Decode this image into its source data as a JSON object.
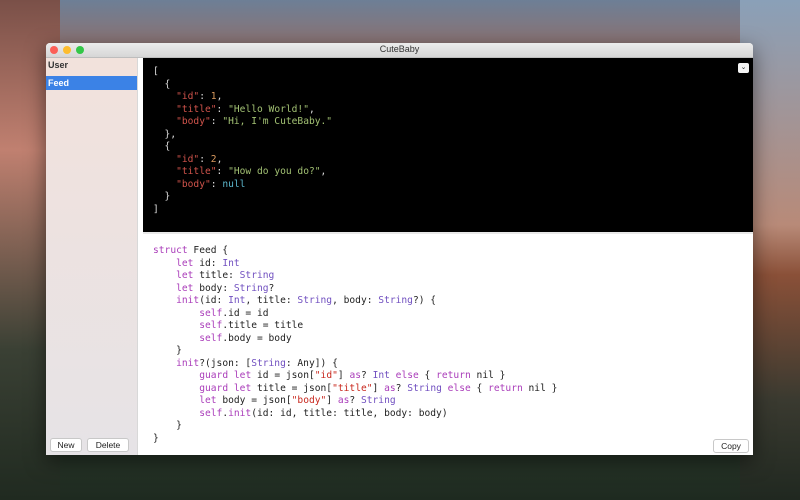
{
  "window": {
    "title": "CuteBaby"
  },
  "sidebar": {
    "header": "User",
    "items": [
      {
        "label": "Feed"
      }
    ],
    "new_label": "New",
    "delete_label": "Delete"
  },
  "json_pane": {
    "dropdown_icon": "chevron-down-icon",
    "lines": [
      [
        [
          "[",
          ""
        ]
      ],
      [
        [
          "  {",
          ""
        ]
      ],
      [
        [
          "    ",
          ""
        ],
        [
          "\"id\"",
          "jk"
        ],
        [
          ": ",
          ""
        ],
        [
          "1",
          "jn"
        ],
        [
          ",",
          ""
        ]
      ],
      [
        [
          "    ",
          ""
        ],
        [
          "\"title\"",
          "jk"
        ],
        [
          ": ",
          ""
        ],
        [
          "\"Hello World!\"",
          "js"
        ],
        [
          ",",
          ""
        ]
      ],
      [
        [
          "    ",
          ""
        ],
        [
          "\"body\"",
          "jk"
        ],
        [
          ": ",
          ""
        ],
        [
          "\"Hi, I'm CuteBaby.\"",
          "js"
        ]
      ],
      [
        [
          "  },",
          ""
        ]
      ],
      [
        [
          "  {",
          ""
        ]
      ],
      [
        [
          "    ",
          ""
        ],
        [
          "\"id\"",
          "jk"
        ],
        [
          ": ",
          ""
        ],
        [
          "2",
          "jn"
        ],
        [
          ",",
          ""
        ]
      ],
      [
        [
          "    ",
          ""
        ],
        [
          "\"title\"",
          "jk"
        ],
        [
          ": ",
          ""
        ],
        [
          "\"How do you do?\"",
          "js"
        ],
        [
          ",",
          ""
        ]
      ],
      [
        [
          "    ",
          ""
        ],
        [
          "\"body\"",
          "jk"
        ],
        [
          ": ",
          ""
        ],
        [
          "null",
          "jl"
        ]
      ],
      [
        [
          "  }",
          ""
        ]
      ],
      [
        [
          "]",
          ""
        ]
      ]
    ]
  },
  "code_pane": {
    "copy_label": "Copy",
    "lines": [
      [
        [
          "struct",
          "k"
        ],
        [
          " Feed {",
          ""
        ]
      ],
      [
        [
          "    ",
          ""
        ],
        [
          "let",
          "k"
        ],
        [
          " id: ",
          ""
        ],
        [
          "Int",
          "t"
        ]
      ],
      [
        [
          "    ",
          ""
        ],
        [
          "let",
          "k"
        ],
        [
          " title: ",
          ""
        ],
        [
          "String",
          "t"
        ]
      ],
      [
        [
          "    ",
          ""
        ],
        [
          "let",
          "k"
        ],
        [
          " body: ",
          ""
        ],
        [
          "String",
          "t"
        ],
        [
          "?",
          ""
        ]
      ],
      [
        [
          "    ",
          ""
        ],
        [
          "init",
          "k"
        ],
        [
          "(id: ",
          ""
        ],
        [
          "Int",
          "t"
        ],
        [
          ", title: ",
          ""
        ],
        [
          "String",
          "t"
        ],
        [
          ", body: ",
          ""
        ],
        [
          "String",
          "t"
        ],
        [
          "?) {",
          ""
        ]
      ],
      [
        [
          "        ",
          ""
        ],
        [
          "self",
          "k"
        ],
        [
          ".id = id",
          ""
        ]
      ],
      [
        [
          "        ",
          ""
        ],
        [
          "self",
          "k"
        ],
        [
          ".title = title",
          ""
        ]
      ],
      [
        [
          "        ",
          ""
        ],
        [
          "self",
          "k"
        ],
        [
          ".body = body",
          ""
        ]
      ],
      [
        [
          "    }",
          ""
        ]
      ],
      [
        [
          "    ",
          ""
        ],
        [
          "init",
          "k"
        ],
        [
          "?(json: [",
          ""
        ],
        [
          "String",
          "t"
        ],
        [
          ": Any]) {",
          ""
        ]
      ],
      [
        [
          "        ",
          ""
        ],
        [
          "guard",
          "k"
        ],
        [
          " ",
          ""
        ],
        [
          "let",
          "k"
        ],
        [
          " id = json[",
          ""
        ],
        [
          "\"id\"",
          "s"
        ],
        [
          "] ",
          ""
        ],
        [
          "as",
          "k"
        ],
        [
          "? ",
          ""
        ],
        [
          "Int",
          "t"
        ],
        [
          " ",
          ""
        ],
        [
          "else",
          "k"
        ],
        [
          " { ",
          ""
        ],
        [
          "return",
          "k"
        ],
        [
          " nil }",
          ""
        ]
      ],
      [
        [
          "        ",
          ""
        ],
        [
          "guard",
          "k"
        ],
        [
          " ",
          ""
        ],
        [
          "let",
          "k"
        ],
        [
          " title = json[",
          ""
        ],
        [
          "\"title\"",
          "s"
        ],
        [
          "] ",
          ""
        ],
        [
          "as",
          "k"
        ],
        [
          "? ",
          ""
        ],
        [
          "String",
          "t"
        ],
        [
          " ",
          ""
        ],
        [
          "else",
          "k"
        ],
        [
          " { ",
          ""
        ],
        [
          "return",
          "k"
        ],
        [
          " nil }",
          ""
        ]
      ],
      [
        [
          "        ",
          ""
        ],
        [
          "let",
          "k"
        ],
        [
          " body = json[",
          ""
        ],
        [
          "\"body\"",
          "s"
        ],
        [
          "] ",
          ""
        ],
        [
          "as",
          "k"
        ],
        [
          "? ",
          ""
        ],
        [
          "String",
          "t"
        ]
      ],
      [
        [
          "        ",
          ""
        ],
        [
          "self",
          "k"
        ],
        [
          ".",
          ""
        ],
        [
          "init",
          "k"
        ],
        [
          "(id: id, title: title, body: body)",
          ""
        ]
      ],
      [
        [
          "    }",
          ""
        ]
      ],
      [
        [
          "}",
          ""
        ]
      ]
    ]
  }
}
